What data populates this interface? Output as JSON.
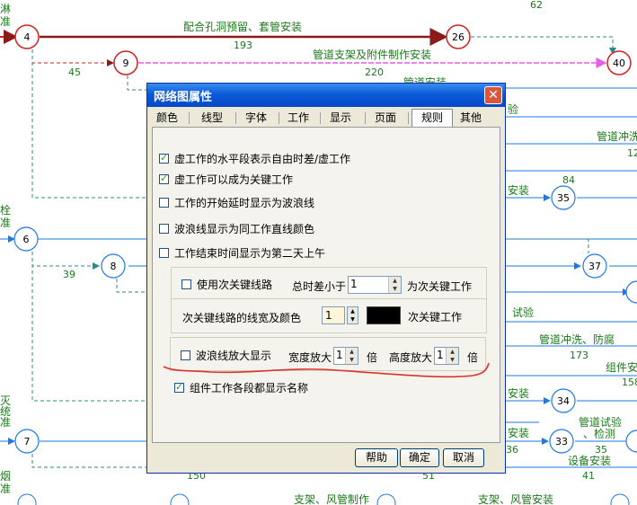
{
  "network": {
    "nodes": [
      "4",
      "9",
      "26",
      "40",
      "6",
      "8",
      "7",
      "35",
      "37",
      "34",
      "33"
    ],
    "numbers": [
      "62",
      "193",
      "45",
      "220",
      "84",
      "12",
      "39",
      "173",
      "158",
      "36",
      "35",
      "41",
      "150",
      "51"
    ],
    "labels": {
      "pipe_hole": "配合孔洞预留、套管安装",
      "support": "管道支架及附件制作安装",
      "top_left_1": "淋",
      "top_left_2": "准",
      "trial1": "验",
      "flush1": "管道冲洗",
      "install1": "安装",
      "left_shuan": "栓",
      "left_zhun": "准",
      "trial2": "试验",
      "flush2": "管道冲洗、防腐",
      "component": "组件安",
      "install2": "安装",
      "left_mie": "灭",
      "left_tong": "统",
      "left_zhun2": "准",
      "install3": "安装",
      "pipe_test": "管道试验",
      "pipe_test2": "、检测",
      "equip": "设备安装",
      "left_yan": "烟",
      "left_zhun3": "准",
      "bottom1": "支架、风管制作",
      "bottom2": "支架、风管安装",
      "top_cut": "管道安装"
    }
  },
  "dialog": {
    "title": "网络图属性",
    "close_icon": "close-icon",
    "tabs": [
      "颜色",
      "线型",
      "字体",
      "工作",
      "显示",
      "页面",
      "规则",
      "其他"
    ],
    "active_tab": "规则",
    "options": [
      {
        "label": "虚工作的水平段表示自由时差/虚工作",
        "checked": true
      },
      {
        "label": "虚工作可以成为关键工作",
        "checked": true
      },
      {
        "label": "工作的开始延时显示为波浪线",
        "checked": false
      },
      {
        "label": "波浪线显示为同工作直线颜色",
        "checked": false
      },
      {
        "label": "工作结束时间显示为第二天上午",
        "checked": false
      }
    ],
    "sub_critical": {
      "checkbox_label": "使用次关键线路",
      "checked": false,
      "float_label": "总时差小于",
      "float_value": "1",
      "float_suffix": "为次关键工作",
      "width_color_label": "次关键线路的线宽及颜色",
      "width_value": "1",
      "legend_label": "次关键工作",
      "line_color": "#000000"
    },
    "wave": {
      "checkbox_label": "波浪线放大显示",
      "checked": false,
      "width_label": "宽度放大",
      "width_value": "1",
      "width_unit": "倍",
      "height_label": "高度放大",
      "height_value": "1",
      "height_unit": "倍"
    },
    "component_names": {
      "label": "组件工作各段都显示名称",
      "checked": true
    },
    "buttons": {
      "help": "帮助",
      "ok": "确定",
      "cancel": "取消"
    },
    "annotation_color": "#e0302a"
  }
}
